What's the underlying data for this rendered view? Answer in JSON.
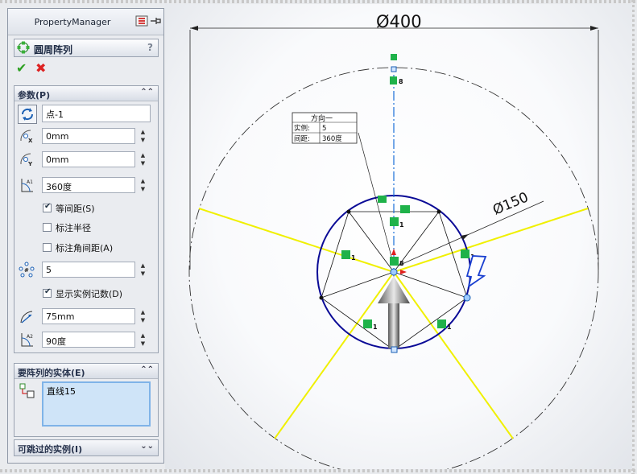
{
  "property_manager": {
    "title": "PropertyManager",
    "feature_name": "圆周阵列",
    "help": "?",
    "ok_glyph": "✔",
    "cancel_glyph": "✖"
  },
  "params": {
    "title": "参数(P)",
    "center_point": "点-1",
    "x_value": "0mm",
    "y_value": "0mm",
    "angle": "360度",
    "equal_spacing_label": "等间距(S)",
    "equal_spacing_checked": true,
    "dim_radius_label": "标注半径",
    "dim_radius_checked": false,
    "dim_angle_label": "标注角间距(A)",
    "dim_angle_checked": false,
    "count": "5",
    "show_count_label": "显示实例记数(D)",
    "show_count_checked": true,
    "radius": "75mm",
    "arc_angle": "90度"
  },
  "entities": {
    "title": "要阵列的实体(E)",
    "items": [
      "直线15"
    ]
  },
  "skip": {
    "title": "可跳过的实例(I)"
  },
  "canvas": {
    "dim_outer": "Ø400",
    "dim_inner": "Ø150",
    "table_title": "方向一",
    "table_instances_label": "实例:",
    "table_instances_value": "5",
    "table_spacing_label": "间距:",
    "table_spacing_value": "360度",
    "relation_eight": "8",
    "relation_one": "1",
    "colors": {
      "circle_blue": "#0a0a96",
      "construction_yellow": "#f0f000",
      "centerline": "#1a6fd8",
      "relation_green": "#1fb24a"
    }
  }
}
